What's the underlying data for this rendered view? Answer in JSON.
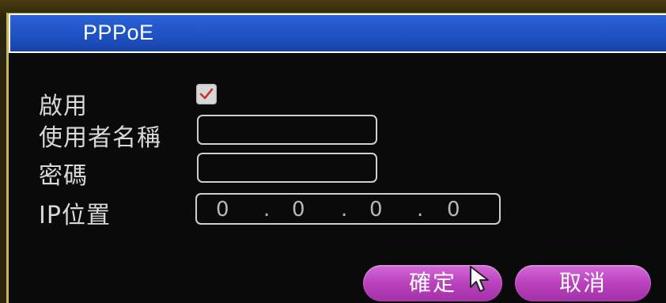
{
  "dialog": {
    "title": "PPPoE"
  },
  "form": {
    "enable_label": "啟用",
    "enable_checked": true,
    "username_label": "使用者名稱",
    "username_value": "",
    "password_label": "密碼",
    "password_value": "",
    "ip_label": "IP位置",
    "ip_octets": [
      "0",
      "0",
      "0",
      "0"
    ],
    "ip_separator": "."
  },
  "buttons": {
    "ok_label": "確定",
    "cancel_label": "取消"
  },
  "colors": {
    "titlebar": "#1f52c4",
    "button": "#b941bd",
    "check_mark": "#c0392b"
  }
}
